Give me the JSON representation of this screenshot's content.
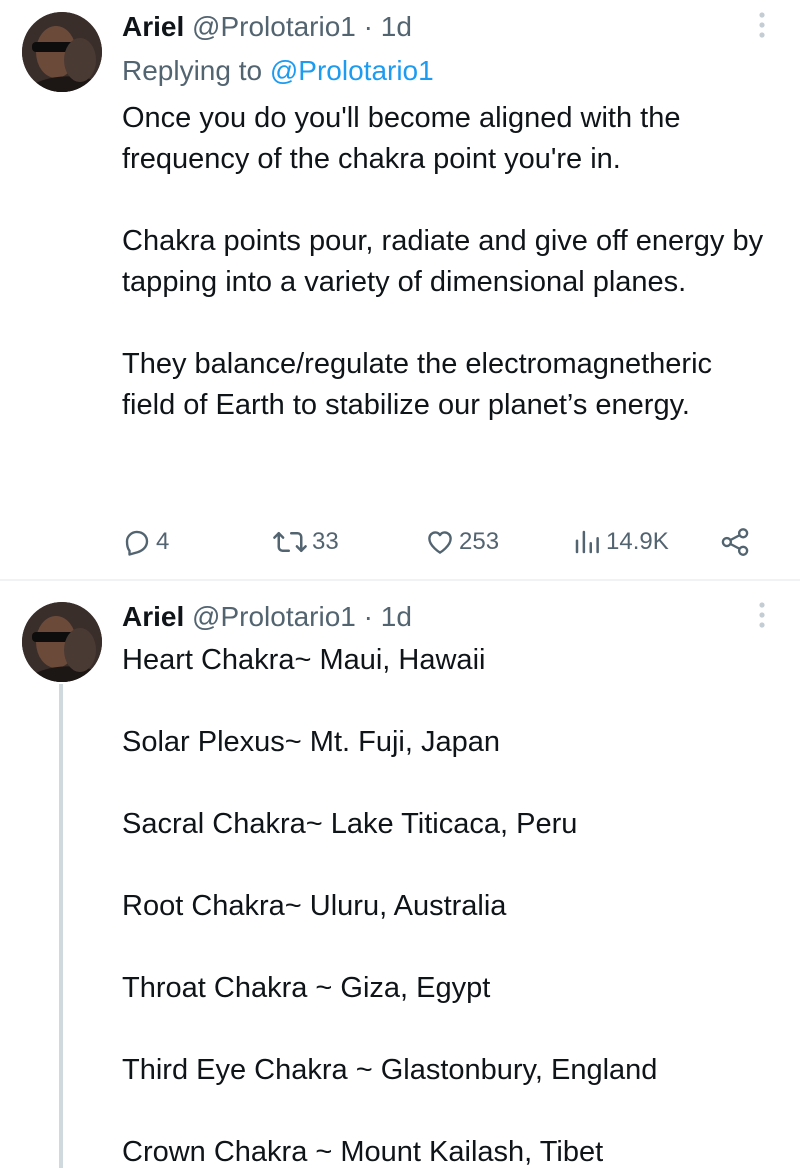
{
  "tweets": [
    {
      "author": {
        "name": "Ariel",
        "handle": "@Prolotario1"
      },
      "separator": "·",
      "time": "1d",
      "replying_prefix": "Replying to ",
      "replying_to": "@Prolotario1",
      "paragraphs": [
        "Once you do you'll become aligned with the frequency of the chakra point you're in.",
        "Chakra points pour, radiate and give off energy by tapping into a variety of dimensional planes.",
        "They balance/regulate the electromagnetheric field of Earth to stabilize our planet’s energy."
      ],
      "actions": {
        "replies": "4",
        "retweets": "33",
        "likes": "253",
        "views": "14.9K"
      },
      "icons": [
        "reply-icon",
        "retweet-icon",
        "like-icon",
        "views-icon",
        "share-icon",
        "more-icon"
      ]
    },
    {
      "author": {
        "name": "Ariel",
        "handle": "@Prolotario1"
      },
      "separator": "·",
      "time": "1d",
      "paragraphs": [
        "Heart Chakra~ Maui, Hawaii",
        "Solar Plexus~ Mt. Fuji, Japan",
        "Sacral Chakra~ Lake Titicaca, Peru",
        "Root Chakra~ Uluru, Australia",
        "Throat Chakra ~ Giza, Egypt",
        "Third Eye Chakra ~ Glastonbury, England",
        "Crown Chakra ~ Mount Kailash, Tibet"
      ]
    }
  ],
  "colors": {
    "text": "#0f1419",
    "secondary": "#536471",
    "link": "#1d9bf0",
    "divider": "#eff3f4",
    "thread_line": "#cfd9de"
  }
}
